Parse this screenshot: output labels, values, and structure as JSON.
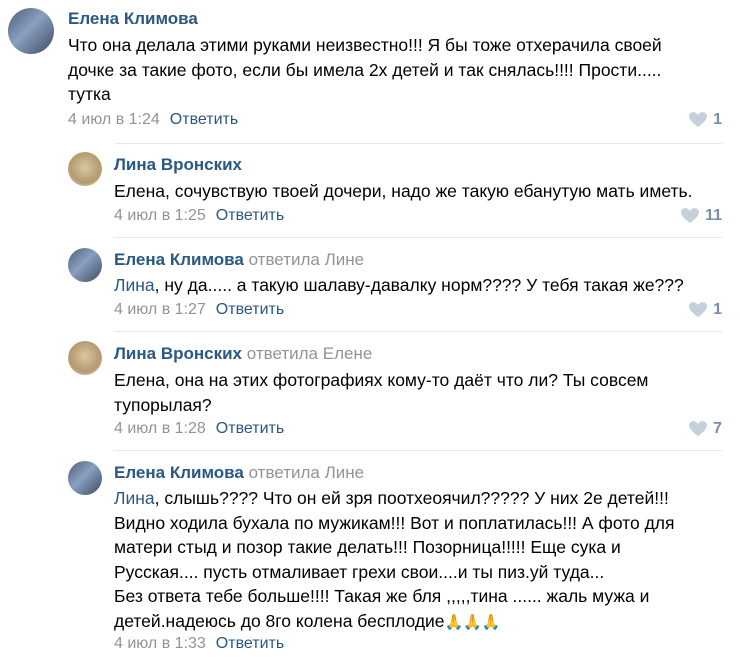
{
  "comments": [
    {
      "author": "Елена Климова",
      "subtitle": "",
      "mention": "",
      "lines": [
        "Что она делала этими руками неизвестно!!! Я бы тоже отхерачила своей",
        "дочке за такие фото, если бы имела 2х детей и так снялась!!!! Прости.....",
        "тутка"
      ],
      "date": "4 июл в 1:24",
      "reply": "Ответить",
      "likes": "1"
    },
    {
      "author": "Лина Вронских",
      "subtitle": "",
      "mention": "",
      "lines": [
        "Елена, сочувствую твоей дочери, надо же такую ебанутую мать иметь."
      ],
      "date": "4 июл в 1:25",
      "reply": "Ответить",
      "likes": "11"
    },
    {
      "author": "Елена Климова",
      "subtitle": "ответила Лине",
      "mention": "Лина",
      "lines": [
        ", ну да..... а такую шалаву-давалку норм???? У тебя такая же???"
      ],
      "date": "4 июл в 1:27",
      "reply": "Ответить",
      "likes": "1"
    },
    {
      "author": "Лина Вронских",
      "subtitle": "ответила Елене",
      "mention": "",
      "lines": [
        "Елена, она на этих фотографиях кому-то даёт что ли? Ты совсем",
        "тупорылая?"
      ],
      "date": "4 июл в 1:28",
      "reply": "Ответить",
      "likes": "7"
    },
    {
      "author": "Елена Климова",
      "subtitle": "ответила Лине",
      "mention": "Лина",
      "lines": [
        ", слышь???? Что он ей зря поотхеоячил????? У них 2е детей!!!",
        "Видно ходила бухала по мужикам!!! Вот и поплатилась!!! А фото для",
        "матери стыд и позор такие делать!!! Позорница!!!!! Еще сука и",
        "Русская.... пусть отмаливает грехи свои....и ты пиз.уй туда...",
        "Без ответа тебе больше!!!! Такая же бля ,,,,,тина ...... жаль мужа и",
        "детей.надеюсь до 8го колена бесплодие"
      ],
      "emoji": "🙏🙏🙏",
      "date": "4 июл в 1:33",
      "reply": "Ответить",
      "likes": ""
    }
  ],
  "icons": {
    "like": "heart-icon"
  },
  "colors": {
    "link": "#2a5885",
    "muted": "#939393",
    "divider": "#e7e8ec"
  }
}
